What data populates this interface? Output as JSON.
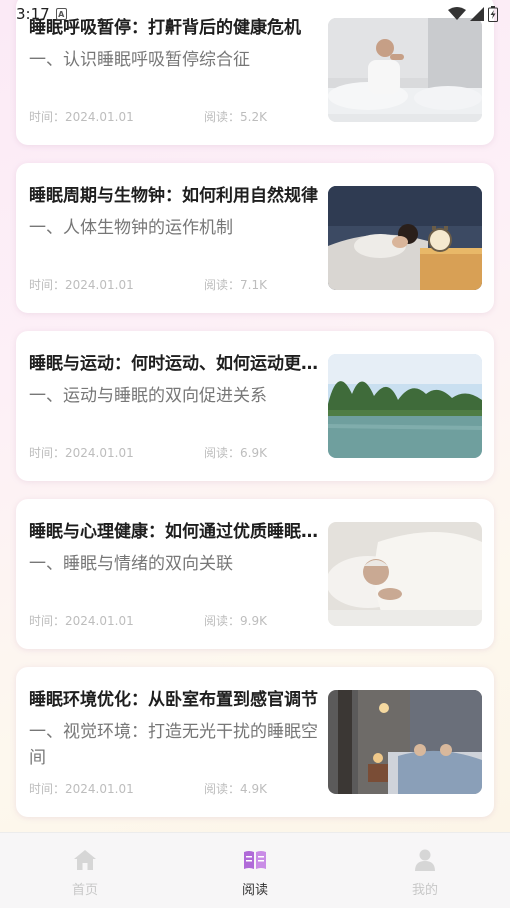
{
  "status_bar": {
    "time": "3:17",
    "notification_icon": "a-letter-icon",
    "icons": [
      "wifi-icon",
      "signal-icon",
      "battery-charging-icon"
    ]
  },
  "articles": [
    {
      "title": "睡眠呼吸暂停：打鼾背后的健康危机",
      "summary": "一、认识睡眠呼吸暂停综合征",
      "time": "时间：2024.01.01",
      "reads": "阅读：5.2K",
      "thumb": "man-stretching-in-bed"
    },
    {
      "title": "睡眠周期与生物钟：如何利用自然规律",
      "summary": "一、人体生物钟的运作机制",
      "time": "时间：2024.01.01",
      "reads": "阅读：7.1K",
      "thumb": "woman-sleeping-alarm-clock"
    },
    {
      "title": "睡眠与运动：何时运动、如何运动更助眠",
      "summary": "一、运动与睡眠的双向促进关系",
      "time": "时间：2024.01.01",
      "reads": "阅读：6.9K",
      "thumb": "karst-river-landscape"
    },
    {
      "title": "睡眠与心理健康：如何通过优质睡眠改善情绪",
      "summary": "一、睡眠与情绪的双向关联",
      "time": "时间：2024.01.01",
      "reads": "阅读：9.9K",
      "thumb": "elderly-man-sleeping"
    },
    {
      "title": "睡眠环境优化：从卧室布置到感官调节",
      "summary": "一、视觉环境：打造无光干扰的睡眠空间",
      "time": "时间：2024.01.01",
      "reads": "阅读：4.9K",
      "thumb": "elderly-couple-in-bedroom"
    }
  ],
  "tabbar": {
    "tabs": [
      {
        "label": "首页",
        "icon": "home-icon",
        "active": false
      },
      {
        "label": "阅读",
        "icon": "book-icon",
        "active": true
      },
      {
        "label": "我的",
        "icon": "user-icon",
        "active": false
      }
    ],
    "active_color": "#b06ad8",
    "inactive_color": "#d6d6d6"
  }
}
